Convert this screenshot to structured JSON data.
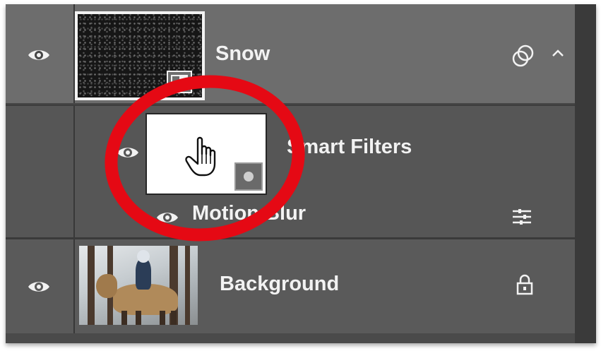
{
  "layers_panel": {
    "snow_layer": {
      "name": "Snow",
      "icons": [
        "visibility-eye-icon",
        "smart-object-icon",
        "filter-effects-icon",
        "collapse-chevron-icon"
      ]
    },
    "smart_filters": {
      "label": "Smart Filters",
      "icons": [
        "visibility-eye-icon",
        "filter-mask-icon"
      ]
    },
    "motion_blur": {
      "label": "Motion Blur",
      "icons": [
        "visibility-eye-icon",
        "filter-blending-options-icon"
      ]
    },
    "background_layer": {
      "name": "Background",
      "icons": [
        "visibility-eye-icon",
        "lock-icon"
      ]
    }
  },
  "annotation": {
    "highlight_color": "#e50914",
    "cursor": "hand-pointer-icon"
  },
  "colors": {
    "panel_bg": "#464646",
    "selected_row": "#6d6d6d",
    "text": "#f2f2f2"
  }
}
